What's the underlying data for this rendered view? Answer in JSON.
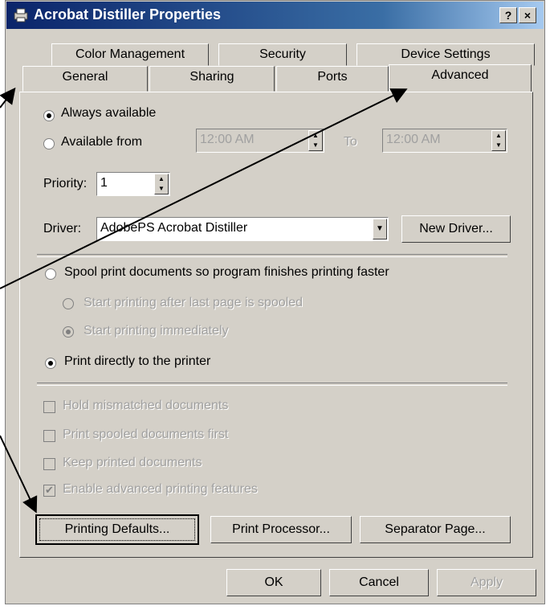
{
  "window": {
    "title": "Acrobat Distiller Properties",
    "help_label": "?",
    "close_label": "×"
  },
  "tabs": {
    "row1": [
      "Color Management",
      "Security",
      "Device Settings"
    ],
    "row2": [
      "General",
      "Sharing",
      "Ports",
      "Advanced"
    ],
    "active": "Advanced"
  },
  "availability": {
    "always_label": "Always available",
    "from_label": "Available from",
    "from_value": "12:00 AM",
    "to_label": "To",
    "to_value": "12:00 AM",
    "selected": "always"
  },
  "priority": {
    "label": "Priority:",
    "value": "1"
  },
  "driver": {
    "label": "Driver:",
    "value": "AdobePS Acrobat Distiller",
    "new_driver_label": "New Driver..."
  },
  "spool": {
    "spool_label": "Spool print documents so program finishes printing faster",
    "after_last_label": "Start printing after last page is spooled",
    "immediately_label": "Start printing immediately",
    "direct_label": "Print directly to the printer",
    "selected": "direct"
  },
  "options": [
    {
      "label": "Hold mismatched documents",
      "checked": false
    },
    {
      "label": "Print spooled documents first",
      "checked": false
    },
    {
      "label": "Keep printed documents",
      "checked": false
    },
    {
      "label": "Enable advanced printing features",
      "checked": true
    }
  ],
  "panel_buttons": {
    "printing_defaults": "Printing Defaults...",
    "print_processor": "Print Processor...",
    "separator_page": "Separator Page..."
  },
  "dialog_buttons": {
    "ok": "OK",
    "cancel": "Cancel",
    "apply": "Apply"
  }
}
